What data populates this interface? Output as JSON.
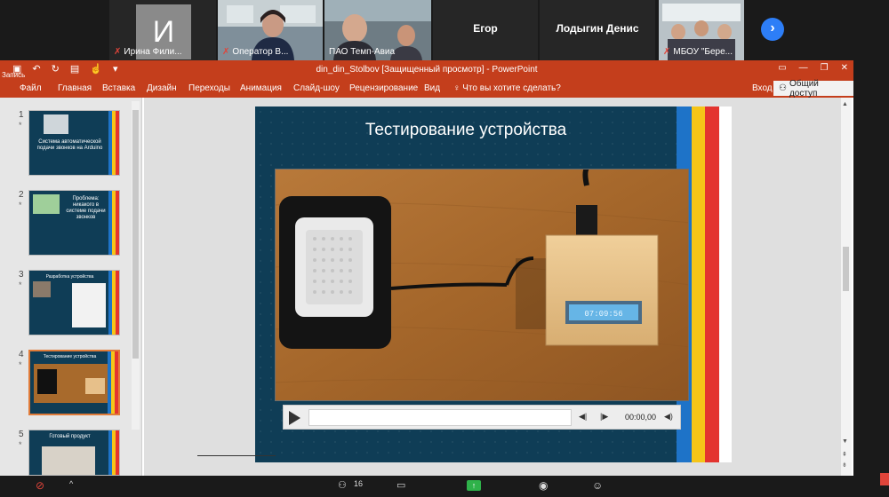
{
  "meeting": {
    "tiles": [
      {
        "name": "Ирина Фили...",
        "initial": "И",
        "muted": true
      },
      {
        "name": "Оператор В...",
        "muted": true
      },
      {
        "name": "ПАО Темп-Авиа",
        "muted": false
      },
      {
        "name": "Егор",
        "muted": false
      },
      {
        "name": "Лодыгин Денис",
        "muted": false
      },
      {
        "name": "МБОУ \"Бере...",
        "muted": true
      }
    ],
    "next_label": "›",
    "recording_label": "Запись",
    "participants_count": "16"
  },
  "powerpoint": {
    "window_title": "din_din_Stolbov [Защищенный просмотр] - PowerPoint",
    "tabs": [
      "Файл",
      "Главная",
      "Вставка",
      "Дизайн",
      "Переходы",
      "Анимация",
      "Слайд-шоу",
      "Рецензирование",
      "Вид"
    ],
    "tell_me": "Что вы хотите сделать?",
    "login": "Вход",
    "share": "Общий доступ",
    "colors": {
      "accent": "#c43e1c",
      "slide_bg": "#0f3d56"
    }
  },
  "thumbnails": [
    {
      "num": "1",
      "title": "Система автоматической подачи звонков на Arduino"
    },
    {
      "num": "2",
      "title": "Проблема: никакого в системе подачи звонков"
    },
    {
      "num": "3",
      "title": "Разработка устройства"
    },
    {
      "num": "4",
      "title": "Тестирование устройства",
      "selected": true
    },
    {
      "num": "5",
      "title": "Готовый продукт"
    }
  ],
  "slide": {
    "title": "Тестирование устройства",
    "stripe_colors": [
      "#1e73c8",
      "#f5c518",
      "#e3342f",
      "#ffffff"
    ],
    "lcd_text": "07:09:56",
    "player": {
      "time": "00:00,00"
    }
  }
}
